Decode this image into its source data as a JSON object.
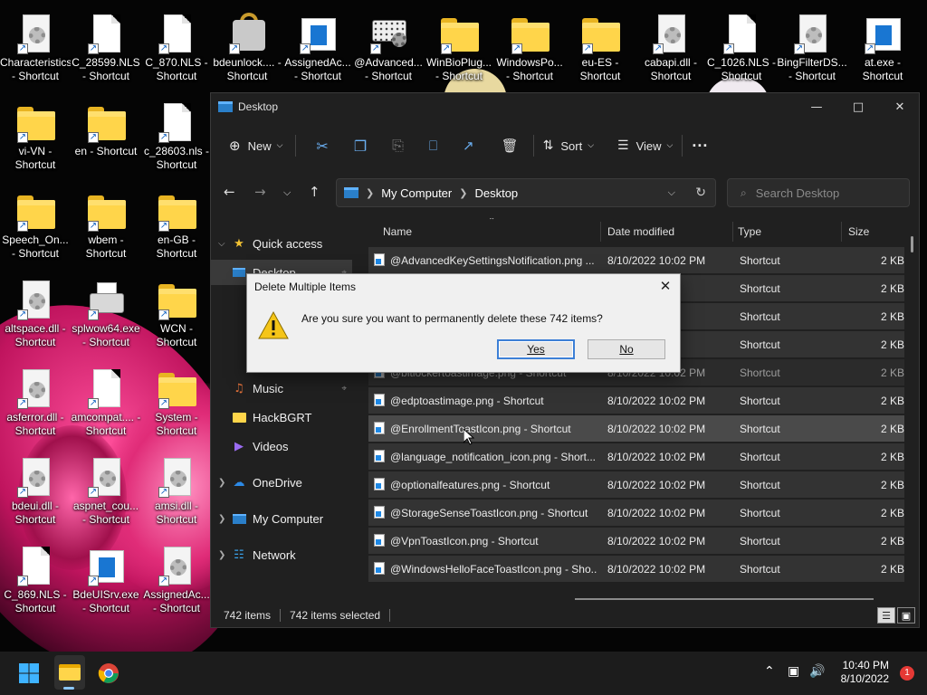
{
  "desktop": {
    "icons": [
      {
        "label": "Characteristics - Shortcut",
        "type": "gear"
      },
      {
        "label": "C_28599.NLS - Shortcut",
        "type": "file"
      },
      {
        "label": "C_870.NLS - Shortcut",
        "type": "file"
      },
      {
        "label": "bdeunlock.... - Shortcut",
        "type": "lock"
      },
      {
        "label": "AssignedAc... - Shortcut",
        "type": "app"
      },
      {
        "label": "@Advanced... - Shortcut",
        "type": "kbd"
      },
      {
        "label": "WinBioPlug... - Shortcut",
        "type": "folder"
      },
      {
        "label": "WindowsPo... - Shortcut",
        "type": "folder"
      },
      {
        "label": "eu-ES - Shortcut",
        "type": "folder"
      },
      {
        "label": "cabapi.dll - Shortcut",
        "type": "gear"
      },
      {
        "label": "C_1026.NLS - Shortcut",
        "type": "file"
      },
      {
        "label": "BingFilterDS... - Shortcut",
        "type": "gear"
      },
      {
        "label": "at.exe - Shortcut",
        "type": "app"
      },
      {
        "label": "vi-VN - Shortcut",
        "type": "folder"
      },
      {
        "label": "en - Shortcut",
        "type": "folder"
      },
      {
        "label": "c_28603.nls - Shortcut",
        "type": "file"
      },
      {
        "label": "Speech_On... - Shortcut",
        "type": "folder"
      },
      {
        "label": "wbem - Shortcut",
        "type": "folder"
      },
      {
        "label": "en-GB - Shortcut",
        "type": "folder"
      },
      {
        "label": "altspace.dll - Shortcut",
        "type": "gear"
      },
      {
        "label": "splwow64.exe - Shortcut",
        "type": "printer"
      },
      {
        "label": "WCN - Shortcut",
        "type": "folder"
      },
      {
        "label": "asferror.dll - Shortcut",
        "type": "gear"
      },
      {
        "label": "amcompat.... - Shortcut",
        "type": "file"
      },
      {
        "label": "System - Shortcut",
        "type": "folder"
      },
      {
        "label": "bdeui.dll - Shortcut",
        "type": "gear"
      },
      {
        "label": "aspnet_cou... - Shortcut",
        "type": "gear"
      },
      {
        "label": "amsi.dll - Shortcut",
        "type": "gear"
      },
      {
        "label": "C_869.NLS - Shortcut",
        "type": "file"
      },
      {
        "label": "BdeUISrv.exe - Shortcut",
        "type": "app"
      },
      {
        "label": "AssignedAc... - Shortcut",
        "type": "gear"
      }
    ]
  },
  "explorer": {
    "title": "Desktop",
    "toolbar": {
      "new": "New",
      "sort": "Sort",
      "view": "View",
      "more": "···"
    },
    "breadcrumb": [
      "My Computer",
      "Desktop"
    ],
    "search_placeholder": "Search Desktop",
    "nav": {
      "quick_access": "Quick access",
      "desktop": "Desktop",
      "music": "Music",
      "hackbgrt": "HackBGRT",
      "videos": "Videos",
      "onedrive": "OneDrive",
      "my_computer": "My Computer",
      "network": "Network"
    },
    "columns": {
      "name": "Name",
      "date": "Date modified",
      "type": "Type",
      "size": "Size"
    },
    "rows": [
      {
        "name": "@AdvancedKeySettingsNotification.png ...",
        "date": "8/10/2022 10:02 PM",
        "type": "Shortcut",
        "size": "2 KB"
      },
      {
        "name": "",
        "date": "PM",
        "type": "Shortcut",
        "size": "2 KB"
      },
      {
        "name": "",
        "date": "PM",
        "type": "Shortcut",
        "size": "2 KB"
      },
      {
        "name": "",
        "date": "PM",
        "type": "Shortcut",
        "size": "2 KB"
      },
      {
        "name": "@bitlockertoastimage.png - Shortcut",
        "date": "8/10/2022 10:02 PM",
        "type": "Shortcut",
        "size": "2 KB"
      },
      {
        "name": "@edptoastimage.png - Shortcut",
        "date": "8/10/2022 10:02 PM",
        "type": "Shortcut",
        "size": "2 KB"
      },
      {
        "name": "@EnrollmentToastIcon.png - Shortcut",
        "date": "8/10/2022 10:02 PM",
        "type": "Shortcut",
        "size": "2 KB"
      },
      {
        "name": "@language_notification_icon.png - Short...",
        "date": "8/10/2022 10:02 PM",
        "type": "Shortcut",
        "size": "2 KB"
      },
      {
        "name": "@optionalfeatures.png - Shortcut",
        "date": "8/10/2022 10:02 PM",
        "type": "Shortcut",
        "size": "2 KB"
      },
      {
        "name": "@StorageSenseToastIcon.png - Shortcut",
        "date": "8/10/2022 10:02 PM",
        "type": "Shortcut",
        "size": "2 KB"
      },
      {
        "name": "@VpnToastIcon.png - Shortcut",
        "date": "8/10/2022 10:02 PM",
        "type": "Shortcut",
        "size": "2 KB"
      },
      {
        "name": "@WindowsHelloFaceToastIcon.png - Sho...",
        "date": "8/10/2022 10:02 PM",
        "type": "Shortcut",
        "size": "2 KB"
      }
    ],
    "status": {
      "count": "742 items",
      "selected": "742 items selected"
    }
  },
  "dialog": {
    "title": "Delete Multiple Items",
    "message": "Are you sure you want to permanently delete these 742 items?",
    "yes": "Yes",
    "no": "No"
  },
  "taskbar": {
    "time": "10:40 PM",
    "date": "8/10/2022",
    "notifications": "1"
  },
  "colors": {
    "accent": "#3c7fd6",
    "folder": "#ffd54a",
    "taskbar": "#1c1c1c",
    "window": "#202020"
  }
}
